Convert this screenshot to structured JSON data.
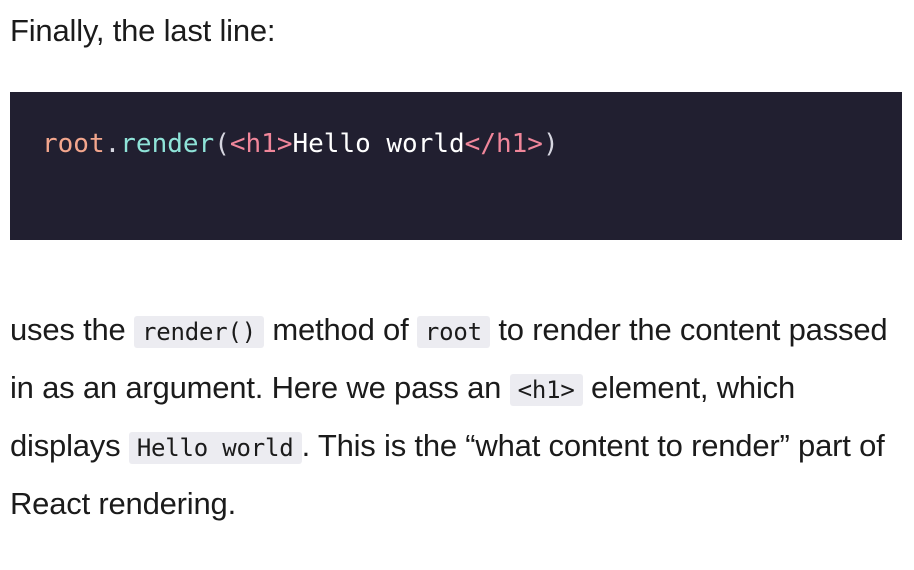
{
  "intro_text": "Finally, the last line:",
  "code": {
    "object": "root",
    "dot": ".",
    "method": "render",
    "open_paren": "(",
    "open_tag": "<h1>",
    "content": "Hello world",
    "close_tag": "</h1>",
    "close_paren": ")"
  },
  "paragraph": {
    "part1": "uses the ",
    "code1": "render()",
    "part2": " method of ",
    "code2": "root",
    "part3": " to render the content passed in as an argument. Here we pass an ",
    "code3": "<h1>",
    "part4": " element, which displays ",
    "code4": "Hello world",
    "part5": ". This is the “what content to render” part of React rendering."
  },
  "colors": {
    "code_background": "#211f30",
    "code_object": "#f3a68d",
    "code_method": "#8fe3d8",
    "code_tag": "#f0869a",
    "inline_code_background": "#ececf1"
  }
}
